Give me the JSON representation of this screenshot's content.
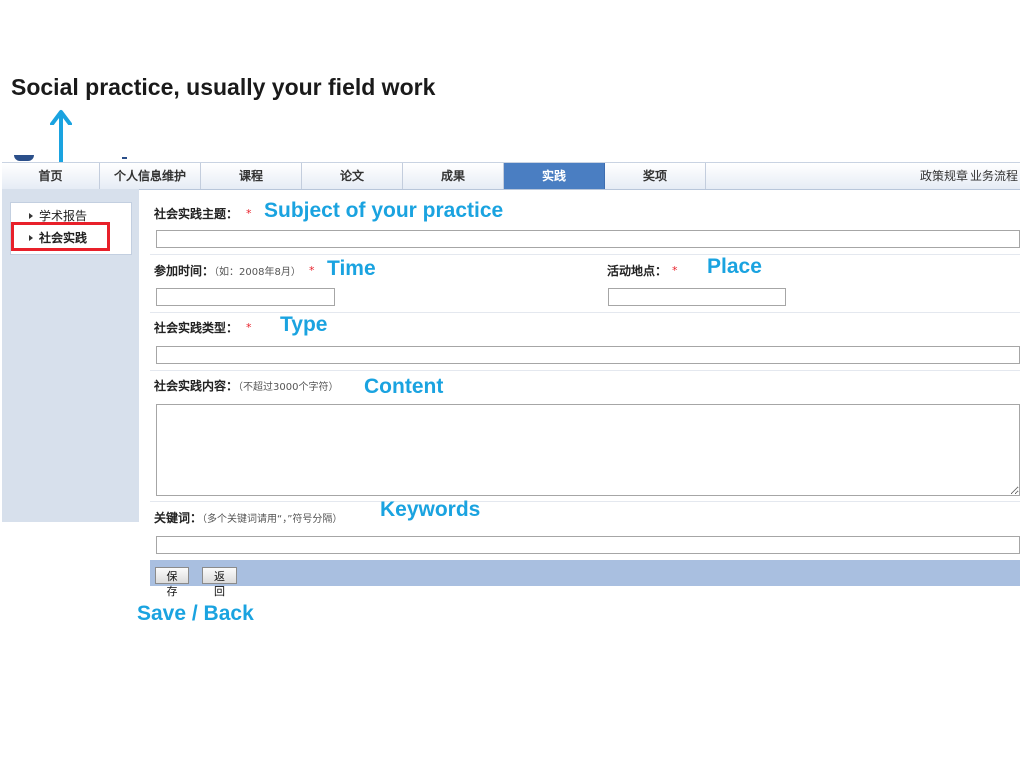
{
  "slide": {
    "title": "Social practice, usually your field work"
  },
  "annotations": {
    "subject": "Subject of your practice",
    "time": "Time",
    "place": "Place",
    "type": "Type",
    "content": "Content",
    "keywords": "Keywords",
    "save_back": "Save / Back"
  },
  "nav": {
    "tabs": [
      "首页",
      "个人信息维护",
      "课程",
      "论文",
      "成果",
      "实践",
      "奖项"
    ],
    "active_tab": "实践",
    "right_links": [
      "政策规章",
      "业务流程"
    ]
  },
  "sidebar": {
    "items": [
      "学术报告",
      "社会实践"
    ],
    "selected": "社会实践"
  },
  "form": {
    "subject": {
      "label": "社会实践主题：",
      "required": "*",
      "value": ""
    },
    "time": {
      "label": "参加时间：",
      "hint": "（如：2008年8月）",
      "required": "*",
      "value": ""
    },
    "place": {
      "label": "活动地点：",
      "required": "*",
      "value": ""
    },
    "type": {
      "label": "社会实践类型：",
      "required": "*",
      "value": ""
    },
    "content": {
      "label": "社会实践内容：",
      "hint": "（不超过3000个字符）",
      "value": ""
    },
    "keywords": {
      "label": "关键词：",
      "hint": "（多个关键词请用“，”符号分隔）",
      "value": ""
    }
  },
  "buttons": {
    "save": "保存",
    "back": "返回"
  },
  "colors": {
    "annotation": "#1aa3e0",
    "nav_active": "#4a7ec2",
    "highlight_box": "#e8202a",
    "sidebar_bg": "#d7e0ec",
    "footer_bar": "#a9bfe0"
  }
}
